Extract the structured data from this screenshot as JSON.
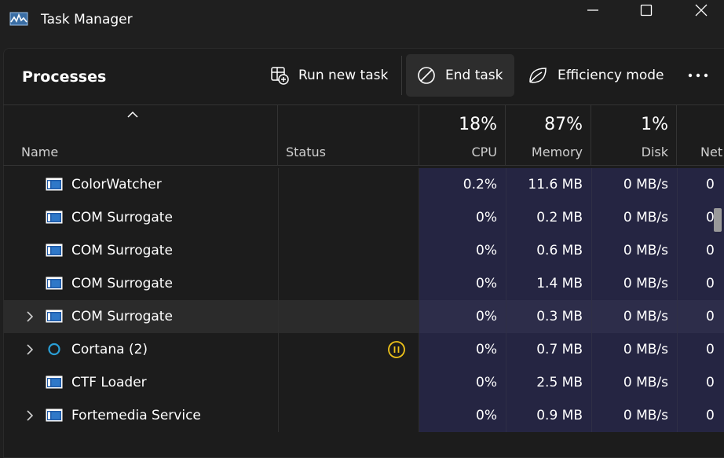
{
  "window": {
    "title": "Task Manager",
    "icon": "task-manager-icon"
  },
  "toolbar": {
    "page_title": "Processes",
    "run_new_task": "Run new task",
    "end_task": "End task",
    "efficiency_mode": "Efficiency mode",
    "more_icon": "more-icon"
  },
  "header": {
    "name": "Name",
    "status": "Status",
    "cpu_pct": "18%",
    "cpu": "CPU",
    "memory_pct": "87%",
    "memory": "Memory",
    "disk_pct": "1%",
    "disk": "Disk",
    "network": "Net"
  },
  "rows": [
    {
      "name": "ColorWatcher",
      "cpu": "0.2%",
      "memory": "11.6 MB",
      "disk": "0 MB/s",
      "net": "0",
      "expandable": false,
      "icon": "app-window-icon",
      "status_icon": "",
      "hover": false
    },
    {
      "name": "COM Surrogate",
      "cpu": "0%",
      "memory": "0.2 MB",
      "disk": "0 MB/s",
      "net": "0",
      "expandable": false,
      "icon": "app-window-icon",
      "status_icon": "",
      "hover": false
    },
    {
      "name": "COM Surrogate",
      "cpu": "0%",
      "memory": "0.6 MB",
      "disk": "0 MB/s",
      "net": "0",
      "expandable": false,
      "icon": "app-window-icon",
      "status_icon": "",
      "hover": false
    },
    {
      "name": "COM Surrogate",
      "cpu": "0%",
      "memory": "1.4 MB",
      "disk": "0 MB/s",
      "net": "0",
      "expandable": false,
      "icon": "app-window-icon",
      "status_icon": "",
      "hover": false
    },
    {
      "name": "COM Surrogate",
      "cpu": "0%",
      "memory": "0.3 MB",
      "disk": "0 MB/s",
      "net": "0",
      "expandable": true,
      "icon": "app-window-icon",
      "status_icon": "",
      "hover": true
    },
    {
      "name": "Cortana (2)",
      "cpu": "0%",
      "memory": "0.7 MB",
      "disk": "0 MB/s",
      "net": "0",
      "expandable": true,
      "icon": "cortana-icon",
      "status_icon": "suspended-icon",
      "hover": false
    },
    {
      "name": "CTF Loader",
      "cpu": "0%",
      "memory": "2.5 MB",
      "disk": "0 MB/s",
      "net": "0",
      "expandable": false,
      "icon": "app-window-icon",
      "status_icon": "",
      "hover": false
    },
    {
      "name": "Fortemedia Service",
      "cpu": "0%",
      "memory": "0.9 MB",
      "disk": "0 MB/s",
      "net": "0",
      "expandable": true,
      "icon": "app-window-icon",
      "status_icon": "",
      "hover": false
    }
  ],
  "colors": {
    "background": "#1f1f1f",
    "metric_column_bg": "#252542",
    "suspended": "#f0c419",
    "cortana": "#2a9fd6"
  }
}
